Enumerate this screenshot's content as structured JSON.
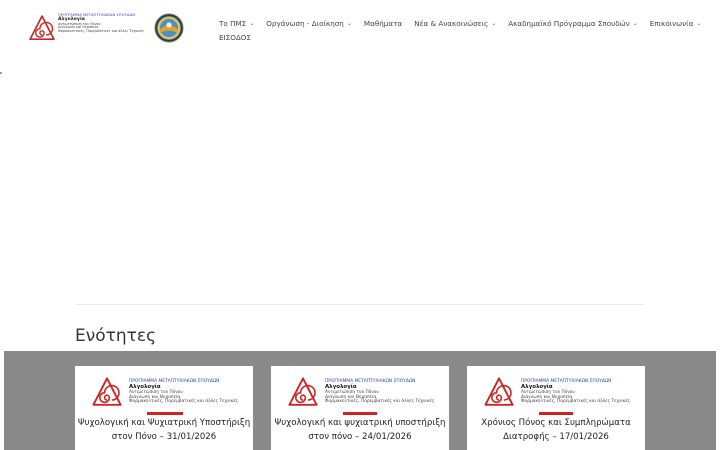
{
  "header": {
    "logo": {
      "line1": "ΠΡΟΓΡΑΜΜΑ ΜΕΤΑΠΤΥΧΙΑΚΩΝ ΣΠΟΥΔΩΝ",
      "line2": "Αλγολογία",
      "line3": "Αντιμετώπιση του Πόνου",
      "line4": "Διάγνωση και Θεραπεία",
      "line5": "Φαρμακευτικές, Παρεμβατικές και άλλες Τεχνικές"
    }
  },
  "nav": {
    "items": [
      {
        "label": "Το ΠΜΣ",
        "dropdown": true
      },
      {
        "label": "Οργάνωση - Διοίκηση",
        "dropdown": true
      },
      {
        "label": "Μαθήματα",
        "dropdown": false
      },
      {
        "label": "Νέα & Ανακοινώσεις",
        "dropdown": true
      },
      {
        "label": "Ακαδημαϊκό Πρόγραμμα Σπουδών",
        "dropdown": true
      },
      {
        "label": "Επικοινωνία",
        "dropdown": true
      }
    ],
    "login": "ΕΙΣΟΔΟΣ"
  },
  "section": {
    "title": "Ενότητες"
  },
  "cards": [
    {
      "title_line1": "Ψυχολογική και Ψυχιατρική Υποστήριξη",
      "title_line2": "στον Πόνο – 31/01/2026"
    },
    {
      "title_line1": "Ψυχολογική και ψυχιατρική υποστήριξη",
      "title_line2": "στον πόνο – 24/01/2026"
    },
    {
      "title_line1": "Χρόνιος Πόνος και Συμπληρώματα",
      "title_line2": "Διατροφής – 17/01/2026"
    }
  ],
  "colors": {
    "brand_red": "#c62828",
    "brand_blue": "#2a4a9b",
    "band_gray": "#8a8a8a",
    "highlight_red": "#d42020"
  },
  "icons": {
    "logo": "spiral-triangle-logo",
    "seal": "university-seal-icon",
    "dropdown": "chevron-down-icon"
  }
}
